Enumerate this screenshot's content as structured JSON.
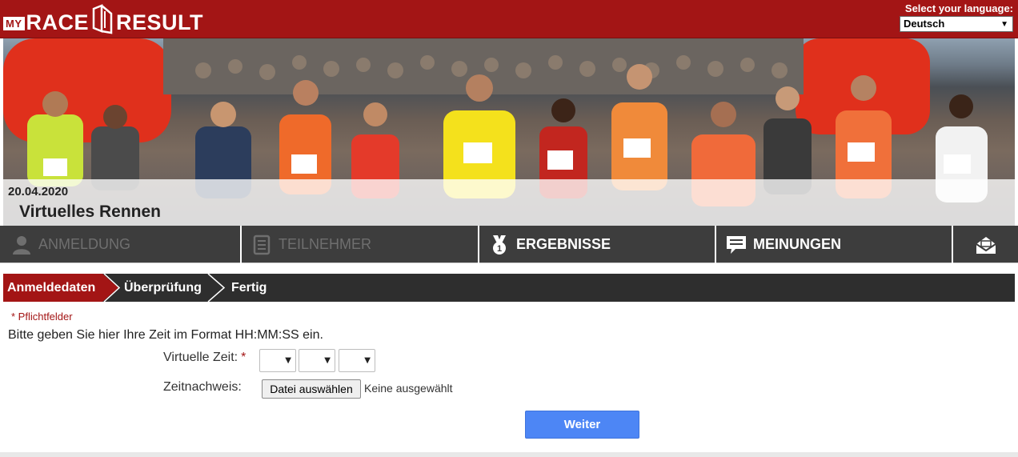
{
  "header": {
    "logo_my": "MY",
    "logo_race": "RACE",
    "logo_result": "RESULT",
    "language_label": "Select your language:",
    "language_selected": "Deutsch"
  },
  "event": {
    "date": "20.04.2020",
    "title": "Virtuelles Rennen"
  },
  "nav": {
    "items": [
      {
        "label": "ANMELDUNG",
        "icon": "user-icon",
        "state": "disabled"
      },
      {
        "label": "TEILNEHMER",
        "icon": "list-icon",
        "state": "disabled"
      },
      {
        "label": "ERGEBNISSE",
        "icon": "medal-icon",
        "state": "active"
      },
      {
        "label": "MEINUNGEN",
        "icon": "chat-icon",
        "state": "active"
      },
      {
        "label": "",
        "icon": "mail-icon",
        "state": "active"
      }
    ]
  },
  "steps": {
    "items": [
      {
        "label": "Anmeldedaten",
        "active": true
      },
      {
        "label": "Überprüfung",
        "active": false
      },
      {
        "label": "Fertig",
        "active": false
      }
    ]
  },
  "form": {
    "required_note": "* Pflichtfelder",
    "instruction": "Bitte geben Sie hier Ihre Zeit im Format HH:MM:SS ein.",
    "time_label": "Virtuelle Zeit:",
    "time_required_mark": "*",
    "hours_value": "",
    "minutes_value": "",
    "seconds_value": "",
    "proof_label": "Zeitnachweis:",
    "file_button": "Datei auswählen",
    "file_status": "Keine ausgewählt",
    "submit": "Weiter"
  },
  "colors": {
    "brand_red": "#a31515",
    "nav_dark": "#3d3d3d",
    "step_dark": "#2e2e2e",
    "button_blue": "#4d86f5"
  }
}
